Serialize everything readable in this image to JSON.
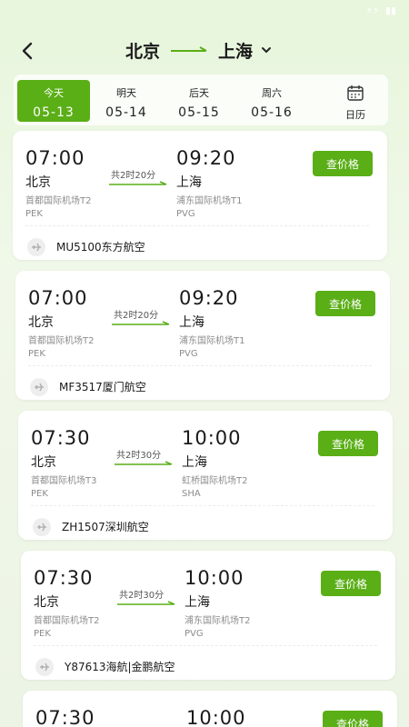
{
  "status_bar": {
    "signal": "⚡⚡",
    "battery": "▮▮"
  },
  "header": {
    "from_city": "北京",
    "to_city": "上海"
  },
  "dates": [
    {
      "weekday": "今天",
      "date": "05-13",
      "active": true
    },
    {
      "weekday": "明天",
      "date": "05-14",
      "active": false
    },
    {
      "weekday": "后天",
      "date": "05-15",
      "active": false
    },
    {
      "weekday": "周六",
      "date": "05-16",
      "active": false
    }
  ],
  "date_peek": "0",
  "calendar": {
    "label": "日历",
    "icon": "calendar-icon"
  },
  "price_label": "查价格",
  "flights": [
    {
      "dep_time": "07:00",
      "dep_city": "北京",
      "dep_airport": "首都国际机场T2",
      "dep_code": "PEK",
      "duration": "共2时20分",
      "arr_time": "09:20",
      "arr_city": "上海",
      "arr_airport": "浦东国际机场T1",
      "arr_code": "PVG",
      "flight": "MU5100东方航空"
    },
    {
      "dep_time": "07:00",
      "dep_city": "北京",
      "dep_airport": "首都国际机场T2",
      "dep_code": "PEK",
      "duration": "共2时20分",
      "arr_time": "09:20",
      "arr_city": "上海",
      "arr_airport": "浦东国际机场T1",
      "arr_code": "PVG",
      "flight": "MF3517厦门航空"
    },
    {
      "dep_time": "07:30",
      "dep_city": "北京",
      "dep_airport": "首都国际机场T3",
      "dep_code": "PEK",
      "duration": "共2时30分",
      "arr_time": "10:00",
      "arr_city": "上海",
      "arr_airport": "虹桥国际机场T2",
      "arr_code": "SHA",
      "flight": "ZH1507深圳航空"
    },
    {
      "dep_time": "07:30",
      "dep_city": "北京",
      "dep_airport": "首都国际机场T2",
      "dep_code": "PEK",
      "duration": "共2时30分",
      "arr_time": "10:00",
      "arr_city": "上海",
      "arr_airport": "浦东国际机场T2",
      "arr_code": "PVG",
      "flight": "Y87613海航|金鹏航空"
    },
    {
      "dep_time": "07:30",
      "arr_time": "10:00"
    }
  ],
  "colors": {
    "accent": "#5aae16",
    "background": "#e7f6dc"
  }
}
